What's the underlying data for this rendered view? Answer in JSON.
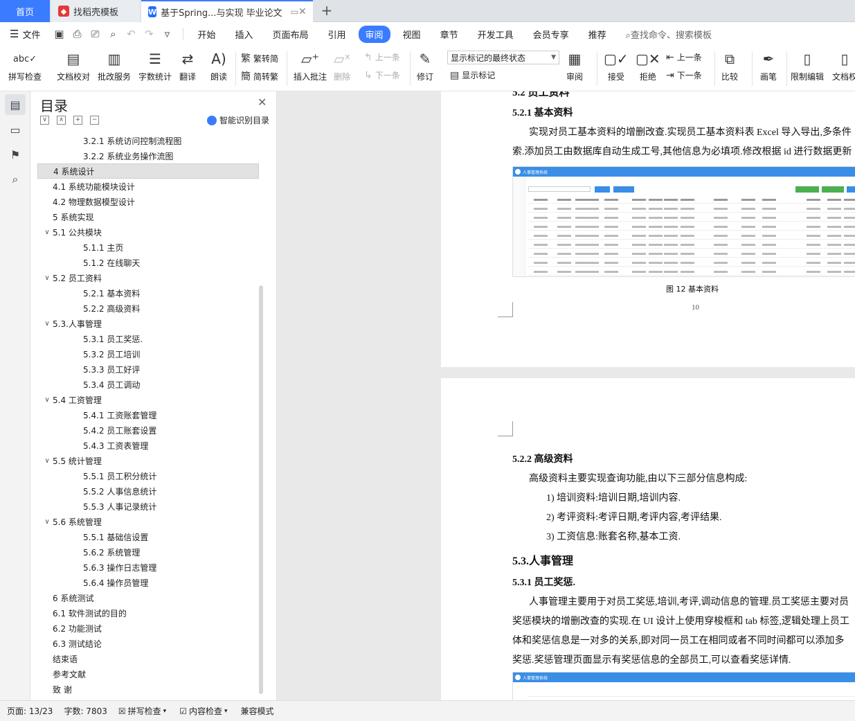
{
  "tabs": {
    "home": "首页",
    "template": "找稻壳模板",
    "document": "基于Spring...与实现 毕业论文"
  },
  "menu": {
    "file": "文件",
    "items": [
      "开始",
      "插入",
      "页面布局",
      "引用",
      "审阅",
      "视图",
      "章节",
      "开发工具",
      "会员专享",
      "推荐"
    ],
    "active": "审阅",
    "search": "查找命令、搜索模板"
  },
  "ribbon": {
    "spellcheck": "拼写检查",
    "doc_proof": "文档校对",
    "review_service": "批改服务",
    "word_count": "字数统计",
    "translate": "翻译",
    "read_aloud": "朗读",
    "to_traditional": "繁转简",
    "to_simplified": "简转繁",
    "insert_comment": "插入批注",
    "delete": "删除",
    "prev_comment": "上一条",
    "next_comment": "下一条",
    "track_changes": "修订",
    "markup_state": "显示标记的最终状态",
    "show_markup": "显示标记",
    "review": "审阅",
    "accept": "接受",
    "reject": "拒绝",
    "prev_change": "上一条",
    "next_change": "下一条",
    "compare": "比较",
    "ink": "画笔",
    "restrict_edit": "限制编辑",
    "doc_rights": "文档权"
  },
  "toc": {
    "title": "目录",
    "smart": "智能识别目录",
    "items": [
      {
        "label": "3.2.1 系统访问控制流程图",
        "level": 3,
        "chev": ""
      },
      {
        "label": "3.2.2 系统业务操作流图",
        "level": 3,
        "chev": ""
      },
      {
        "label": "4 系统设计",
        "level": 1,
        "chev": ""
      },
      {
        "label": "4.1 系统功能模块设计",
        "level": 1,
        "chev": ""
      },
      {
        "label": "4.2 物理数据模型设计",
        "level": 1,
        "chev": ""
      },
      {
        "label": "5 系统实现",
        "level": 1,
        "chev": ""
      },
      {
        "label": "5.1  公共模块",
        "level": 1,
        "chev": "∨"
      },
      {
        "label": "5.1.1 主页",
        "level": 3,
        "chev": ""
      },
      {
        "label": "5.1.2 在线聊天",
        "level": 3,
        "chev": ""
      },
      {
        "label": "5.2  员工资料",
        "level": 1,
        "chev": "∨"
      },
      {
        "label": "5.2.1 基本资料",
        "level": 3,
        "chev": ""
      },
      {
        "label": "5.2.2  高级资料",
        "level": 3,
        "chev": ""
      },
      {
        "label": "5.3.人事管理",
        "level": 1,
        "chev": "∨"
      },
      {
        "label": "5.3.1 员工奖惩.",
        "level": 3,
        "chev": ""
      },
      {
        "label": "5.3.2 员工培训",
        "level": 3,
        "chev": ""
      },
      {
        "label": "5.3.3 员工好评",
        "level": 3,
        "chev": ""
      },
      {
        "label": "5.3.4 员工调动",
        "level": 3,
        "chev": ""
      },
      {
        "label": "5.4 工资管理",
        "level": 1,
        "chev": "∨"
      },
      {
        "label": "5.4.1 工资账套管理",
        "level": 3,
        "chev": ""
      },
      {
        "label": "5.4.2 员工账套设置",
        "level": 3,
        "chev": ""
      },
      {
        "label": "5.4.3 工资表管理",
        "level": 3,
        "chev": ""
      },
      {
        "label": "5.5 统计管理",
        "level": 1,
        "chev": "∨"
      },
      {
        "label": "5.5.1 员工积分统计",
        "level": 3,
        "chev": ""
      },
      {
        "label": "5.5.2 人事信息统计",
        "level": 3,
        "chev": ""
      },
      {
        "label": "5.5.3 人事记录统计",
        "level": 3,
        "chev": ""
      },
      {
        "label": "5.6 系统管理",
        "level": 1,
        "chev": "∨"
      },
      {
        "label": "5.5.1 基础信设置",
        "level": 3,
        "chev": ""
      },
      {
        "label": "5.6.2 系统管理",
        "level": 3,
        "chev": ""
      },
      {
        "label": "5.6.3 操作日志管理",
        "level": 3,
        "chev": ""
      },
      {
        "label": "5.6.4 操作员管理",
        "level": 3,
        "chev": ""
      },
      {
        "label": "6 系统测试",
        "level": 1,
        "chev": ""
      },
      {
        "label": "6.1  软件测试的目的",
        "level": 1,
        "chev": ""
      },
      {
        "label": "6.2  功能测试",
        "level": 1,
        "chev": ""
      },
      {
        "label": "6.3  测试结论",
        "level": 1,
        "chev": ""
      },
      {
        "label": "结束语",
        "level": 1,
        "chev": ""
      },
      {
        "label": "参考文献",
        "level": 1,
        "chev": ""
      },
      {
        "label": "致    谢",
        "level": 1,
        "chev": ""
      }
    ],
    "selected_index": 2
  },
  "doc": {
    "p1_h2": "5.2  员工资料",
    "p1_h3": "5.2.1 基本资料",
    "p1_line1": "实现对员工基本资料的增删改查.实现员工基本资料表 Excel 导入导出,多条件",
    "p1_line2": "索.添加员工由数据库自动生成工号,其他信息为必填项.修改根据 id 进行数据更新",
    "fig_app_title": "人事管理系统",
    "p1_caption": "图 12  基本资料",
    "p1_pagenum": "10",
    "p2_h3": "5.2.2  高级资料",
    "p2_intro": "高级资料主要实现查询功能,由以下三部分信息构成:",
    "p2_list": [
      "1)   培训资料:培训日期,培训内容.",
      "2)   考评资料:考评日期,考评内容,考评结果.",
      "3)   工资信息:账套名称,基本工资."
    ],
    "p2_h2": "5.3.人事管理",
    "p2_h3b": "5.3.1 员工奖惩.",
    "p2_para": [
      "人事管理主要用于对员工奖惩,培训,考评,调动信息的管理.员工奖惩主要对员",
      "奖惩模块的增删改查的实现.在 UI 设计上使用穿梭框和 tab 标签,逻辑处理上员工",
      "体和奖惩信息是一对多的关系,即对同一员工在相同或者不同时间都可以添加多",
      "奖惩.奖惩管理页面显示有奖惩信息的全部员工,可以查看奖惩详情."
    ]
  },
  "status": {
    "page": "页面: 13/23",
    "words": "字数: 7803",
    "spell": "拼写检查",
    "content": "内容检查",
    "mode": "兼容模式"
  },
  "colors": {
    "accent": "#3a7bff",
    "figure_bar": "#3a8ee6"
  }
}
